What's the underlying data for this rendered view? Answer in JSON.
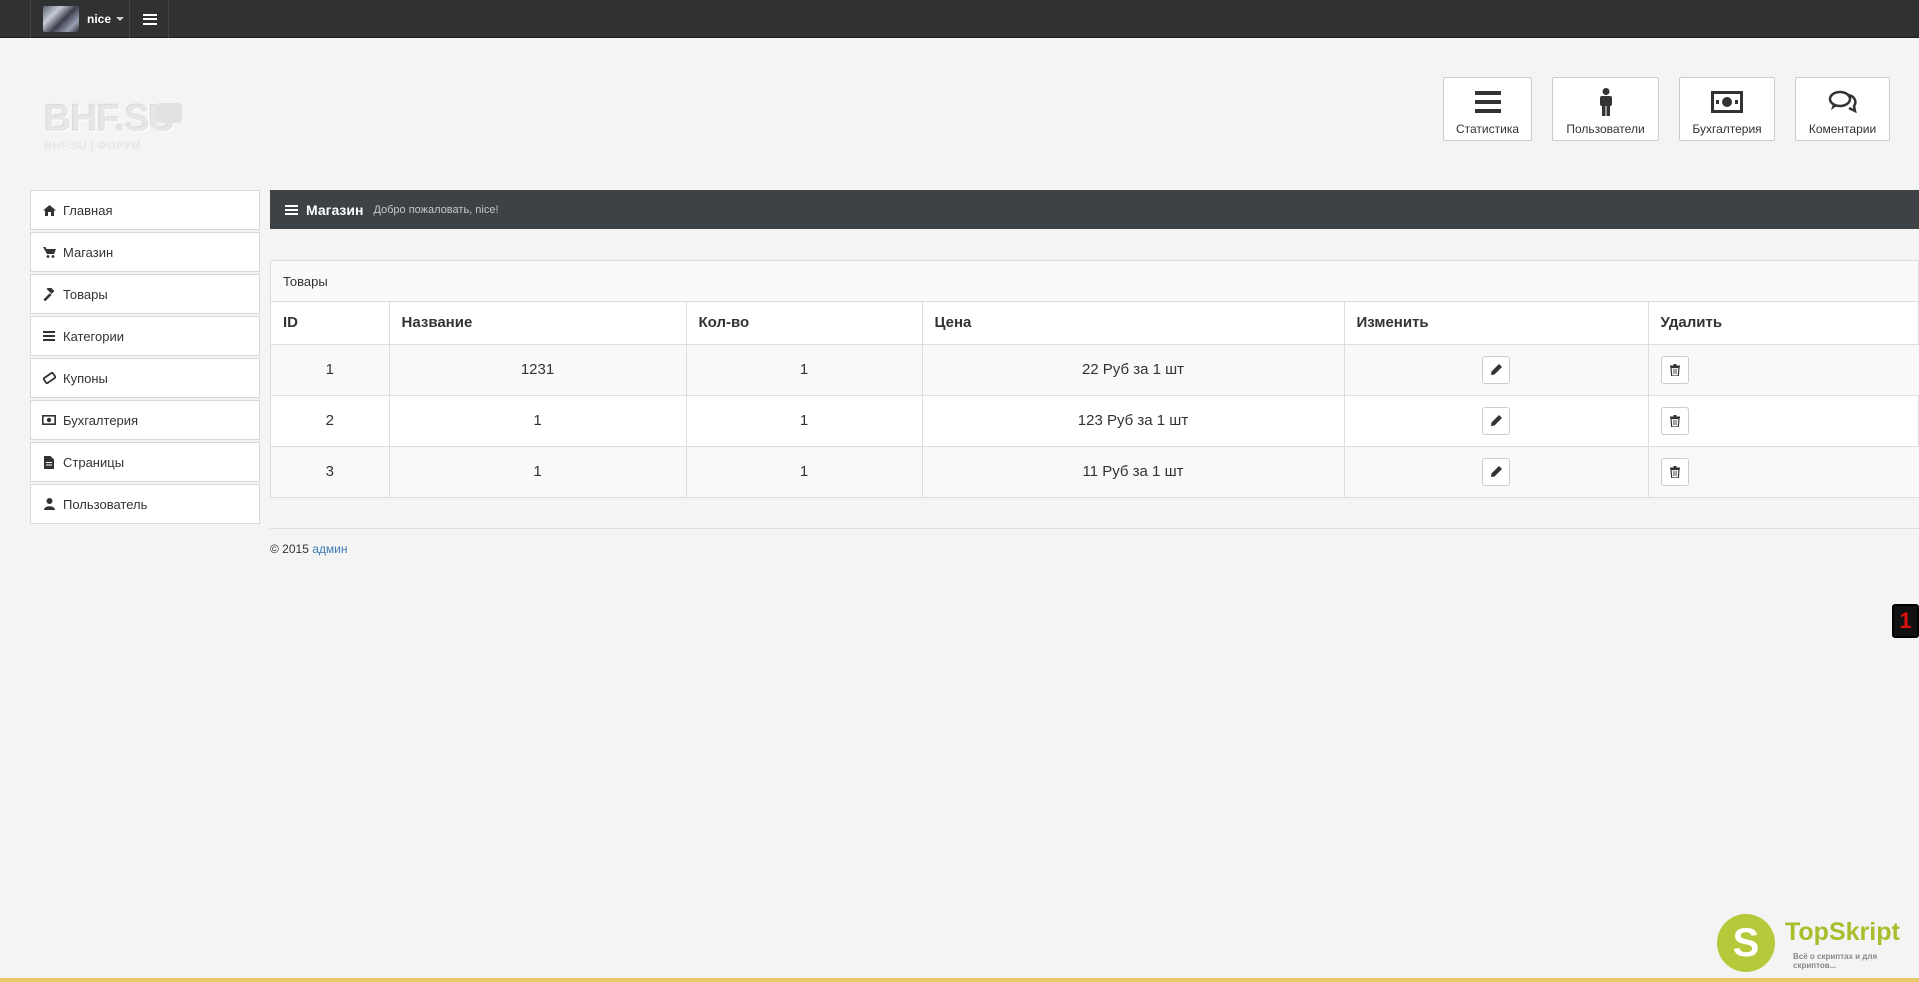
{
  "topbar": {
    "user_name": "nice"
  },
  "logo": {
    "main": "BHF.SU",
    "sub": "BHF.SU | ФОРУМ"
  },
  "quick_buttons": [
    {
      "label": "Статистика",
      "icon": "bars-icon"
    },
    {
      "label": "Пользователи",
      "icon": "male-icon"
    },
    {
      "label": "Бухгалтерия",
      "icon": "money-icon"
    },
    {
      "label": "Коментарии",
      "icon": "comments-icon"
    }
  ],
  "sidebar": {
    "items": [
      {
        "label": "Главная",
        "icon": "home-icon"
      },
      {
        "label": "Магазин",
        "icon": "cart-icon"
      },
      {
        "label": "Товары",
        "icon": "gavel-icon"
      },
      {
        "label": "Категории",
        "icon": "list-icon"
      },
      {
        "label": "Купоны",
        "icon": "ticket-icon"
      },
      {
        "label": "Бухгалтерия",
        "icon": "money-icon"
      },
      {
        "label": "Страницы",
        "icon": "file-icon"
      },
      {
        "label": "Пользователь",
        "icon": "user-icon"
      }
    ]
  },
  "header": {
    "title": "Магазин",
    "subtitle": "Добро пожаловать, nice!"
  },
  "panel": {
    "heading": "Товары",
    "columns": [
      "ID",
      "Название",
      "Кол-во",
      "Цена",
      "Изменить",
      "Удалить"
    ],
    "rows": [
      {
        "id": "1",
        "name": "1231",
        "qty": "1",
        "price": "22 Руб за 1 шт"
      },
      {
        "id": "2",
        "name": "1",
        "qty": "1",
        "price": "123 Руб за 1 шт"
      },
      {
        "id": "3",
        "name": "1",
        "qty": "1",
        "price": "11 Руб за 1 шт"
      }
    ]
  },
  "footer": {
    "copyright": "© 2015",
    "link": "админ"
  },
  "edge_badge": "1",
  "watermark": {
    "letter": "S",
    "title": "TopSkript",
    "subtitle": "Всё о скриптах и для скриптов..."
  },
  "colors": {
    "topbar": "#2f3133",
    "header": "#3d4246",
    "link": "#3a7ab7",
    "watermark": "#b6c93a"
  }
}
